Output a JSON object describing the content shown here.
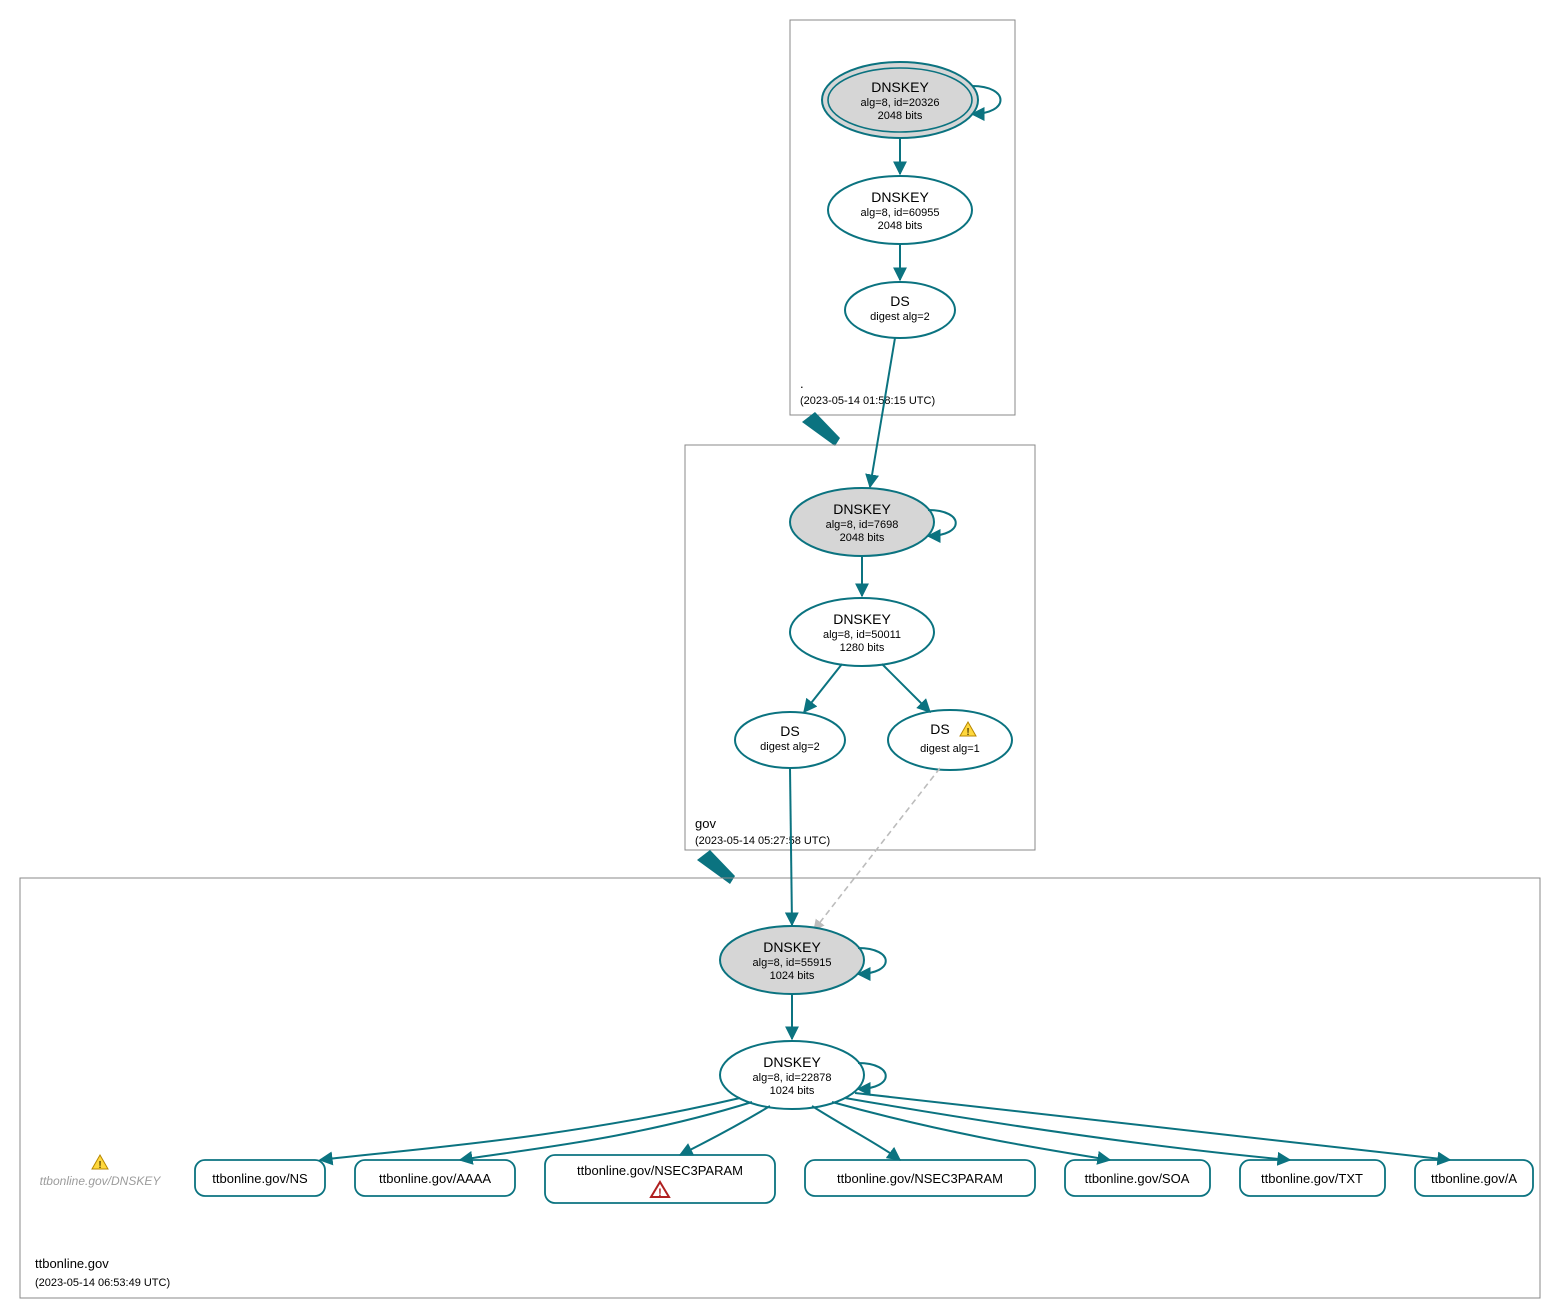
{
  "colors": {
    "teal": "#0b7380",
    "ksk_fill": "#d6d6d6",
    "warn": "#ffd83d",
    "error": "#b02020"
  },
  "zones": {
    "root": {
      "name": ".",
      "timestamp": "(2023-05-14 01:58:15 UTC)"
    },
    "gov": {
      "name": "gov",
      "timestamp": "(2023-05-14 05:27:58 UTC)"
    },
    "ttbonline": {
      "name": "ttbonline.gov",
      "timestamp": "(2023-05-14 06:53:49 UTC)"
    }
  },
  "nodes": {
    "root_ksk": {
      "title": "DNSKEY",
      "line2": "alg=8, id=20326",
      "line3": "2048 bits"
    },
    "root_zsk": {
      "title": "DNSKEY",
      "line2": "alg=8, id=60955",
      "line3": "2048 bits"
    },
    "root_ds": {
      "title": "DS",
      "line2": "digest alg=2"
    },
    "gov_ksk": {
      "title": "DNSKEY",
      "line2": "alg=8, id=7698",
      "line3": "2048 bits"
    },
    "gov_zsk": {
      "title": "DNSKEY",
      "line2": "alg=8, id=50011",
      "line3": "1280 bits"
    },
    "gov_ds1": {
      "title": "DS",
      "line2": "digest alg=2"
    },
    "gov_ds2": {
      "title": "DS",
      "line2": "digest alg=1"
    },
    "ttb_ksk": {
      "title": "DNSKEY",
      "line2": "alg=8, id=55915",
      "line3": "1024 bits"
    },
    "ttb_zsk": {
      "title": "DNSKEY",
      "line2": "alg=8, id=22878",
      "line3": "1024 bits"
    },
    "ttb_dnskey_grey": {
      "label": "ttbonline.gov/DNSKEY"
    },
    "rr_ns": {
      "label": "ttbonline.gov/NS"
    },
    "rr_aaaa": {
      "label": "ttbonline.gov/AAAA"
    },
    "rr_n3a": {
      "label": "ttbonline.gov/NSEC3PARAM"
    },
    "rr_n3b": {
      "label": "ttbonline.gov/NSEC3PARAM"
    },
    "rr_soa": {
      "label": "ttbonline.gov/SOA"
    },
    "rr_txt": {
      "label": "ttbonline.gov/TXT"
    },
    "rr_a": {
      "label": "ttbonline.gov/A"
    }
  }
}
